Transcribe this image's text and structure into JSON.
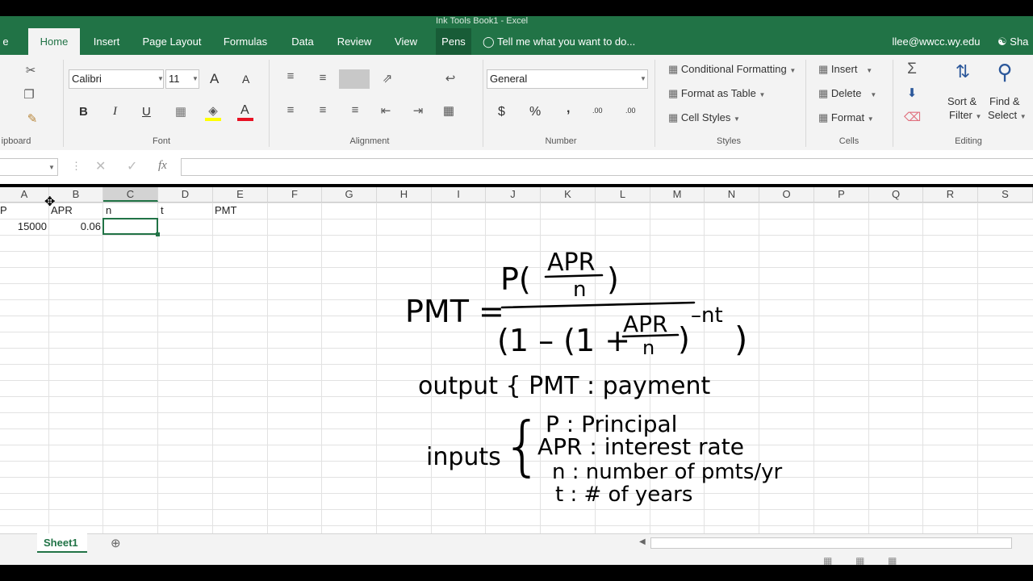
{
  "title_bar": {
    "text": "Ink Tools     Book1 - Excel"
  },
  "tabs": [
    "Home",
    "Insert",
    "Page Layout",
    "Formulas",
    "Data",
    "Review",
    "View",
    "Pens"
  ],
  "tell_me": "Tell me what you want to do...",
  "user_email": "llee@wwcc.wy.edu",
  "share_label": "Sha",
  "clipboard": {
    "label": "ipboard"
  },
  "font": {
    "name": "Calibri",
    "size": "11",
    "label": "Font",
    "bold": "B",
    "italic": "I",
    "underline": "U",
    "grow": "A",
    "shrink": "A"
  },
  "alignment": {
    "label": "Alignment"
  },
  "number": {
    "format": "General",
    "label": "Number",
    "currency": "$",
    "percent": "%",
    "comma": ",",
    "inc_decimal": ".00",
    "dec_decimal": ".00"
  },
  "styles": {
    "label": "Styles",
    "conditional": "Conditional Formatting",
    "format_table": "Format as Table",
    "cell_styles": "Cell Styles"
  },
  "cells": {
    "label": "Cells",
    "insert": "Insert",
    "delete": "Delete",
    "format": "Format"
  },
  "editing": {
    "label": "Editing",
    "sort_filter_1": "Sort &",
    "sort_filter_2": "Filter",
    "find_select_1": "Find &",
    "find_select_2": "Select"
  },
  "formula_bar": {
    "fx": "fx",
    "name_box": "",
    "content": ""
  },
  "columns": [
    "A",
    "B",
    "C",
    "D",
    "E",
    "F",
    "G",
    "H",
    "I",
    "J",
    "K",
    "L",
    "M",
    "N",
    "O",
    "P",
    "Q",
    "R",
    "S"
  ],
  "cells_data": {
    "r1": {
      "a_partial": "P",
      "b": "APR",
      "c": "n",
      "d": "t",
      "e": "PMT"
    },
    "r2": {
      "a": "15000",
      "b": "0.06"
    }
  },
  "ink": {
    "pmt": "PMT =",
    "numerator_p": "P(",
    "numerator_apr": "APR",
    "numerator_n": "n",
    "denom_left": "(1 – (1 +",
    "denom_apr": "APR",
    "denom_n": "n",
    "exponent": "–nt",
    "output": "output { PMT : payment",
    "inputs": "inputs",
    "in_p": "P : Principal",
    "in_apr": "APR : interest rate",
    "in_n": "n : number of pmts/yr",
    "in_t": "t : # of years"
  },
  "sheet_tab": "Sheet1"
}
